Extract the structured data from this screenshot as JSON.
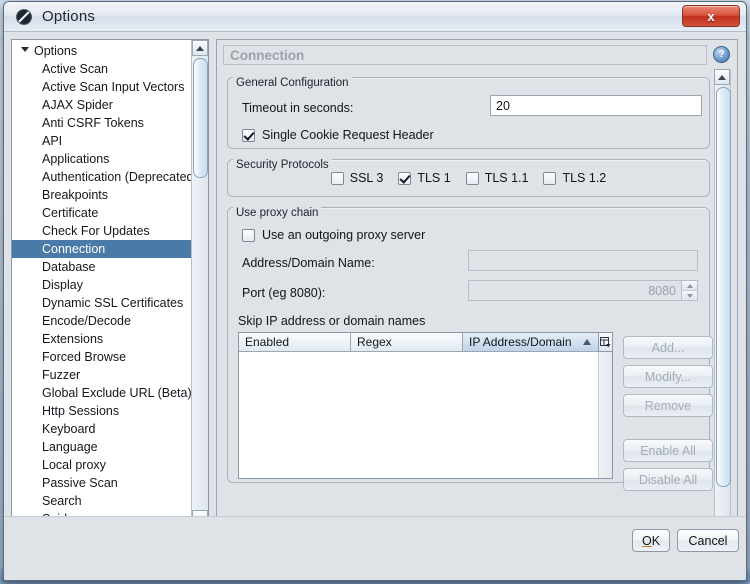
{
  "window": {
    "title": "Options",
    "icon": "zap-icon",
    "close_label": "x"
  },
  "tree": {
    "root": {
      "label": "Options",
      "expanded": true
    },
    "items": [
      {
        "label": "Active Scan",
        "selected": false
      },
      {
        "label": "Active Scan Input Vectors",
        "selected": false
      },
      {
        "label": "AJAX Spider",
        "selected": false
      },
      {
        "label": "Anti CSRF Tokens",
        "selected": false
      },
      {
        "label": "API",
        "selected": false
      },
      {
        "label": "Applications",
        "selected": false
      },
      {
        "label": "Authentication (Deprecated)",
        "selected": false
      },
      {
        "label": "Breakpoints",
        "selected": false
      },
      {
        "label": "Certificate",
        "selected": false
      },
      {
        "label": "Check For Updates",
        "selected": false
      },
      {
        "label": "Connection",
        "selected": true
      },
      {
        "label": "Database",
        "selected": false
      },
      {
        "label": "Display",
        "selected": false
      },
      {
        "label": "Dynamic SSL Certificates",
        "selected": false
      },
      {
        "label": "Encode/Decode",
        "selected": false
      },
      {
        "label": "Extensions",
        "selected": false
      },
      {
        "label": "Forced Browse",
        "selected": false
      },
      {
        "label": "Fuzzer",
        "selected": false
      },
      {
        "label": "Global Exclude URL (Beta)",
        "selected": false
      },
      {
        "label": "Http Sessions",
        "selected": false
      },
      {
        "label": "Keyboard",
        "selected": false
      },
      {
        "label": "Language",
        "selected": false
      },
      {
        "label": "Local proxy",
        "selected": false
      },
      {
        "label": "Passive Scan",
        "selected": false
      },
      {
        "label": "Search",
        "selected": false
      },
      {
        "label": "Spider",
        "selected": false
      }
    ]
  },
  "panel": {
    "header_title": "Connection",
    "help_glyph": "?",
    "general": {
      "legend": "General Configuration",
      "timeout_label": "Timeout in seconds:",
      "timeout_value": "20",
      "single_cookie_label": "Single Cookie Request Header",
      "single_cookie_checked": true
    },
    "security": {
      "legend": "Security Protocols",
      "options": [
        {
          "label": "SSL 3",
          "checked": false
        },
        {
          "label": "TLS 1",
          "checked": true
        },
        {
          "label": "TLS 1.1",
          "checked": false
        },
        {
          "label": "TLS 1.2",
          "checked": false
        }
      ]
    },
    "proxy": {
      "legend": "Use proxy chain",
      "use_outgoing_label": "Use an outgoing proxy server",
      "use_outgoing_checked": false,
      "address_label": "Address/Domain Name:",
      "address_value": "",
      "port_label": "Port (eg 8080):",
      "port_value": "8080",
      "skip_label": "Skip IP address or domain names",
      "table": {
        "columns": [
          {
            "label": "Enabled",
            "sorted": false
          },
          {
            "label": "Regex",
            "sorted": false
          },
          {
            "label": "IP Address/Domain",
            "sorted": true,
            "sort_direction": "ascending"
          }
        ],
        "rows": []
      },
      "buttons": [
        {
          "label": "Add...",
          "enabled": false
        },
        {
          "label": "Modify...",
          "enabled": false
        },
        {
          "label": "Remove",
          "enabled": false
        },
        {
          "label": "Enable All",
          "enabled": false
        },
        {
          "label": "Disable All",
          "enabled": false
        }
      ]
    }
  },
  "footer": {
    "ok_label": "OK",
    "cancel_label": "Cancel"
  },
  "colors": {
    "selection_blue": "#4a7aa8",
    "close_red": "#c0301c",
    "panel_bg": "#dfe3e8",
    "disabled_text": "#a3abb4"
  }
}
